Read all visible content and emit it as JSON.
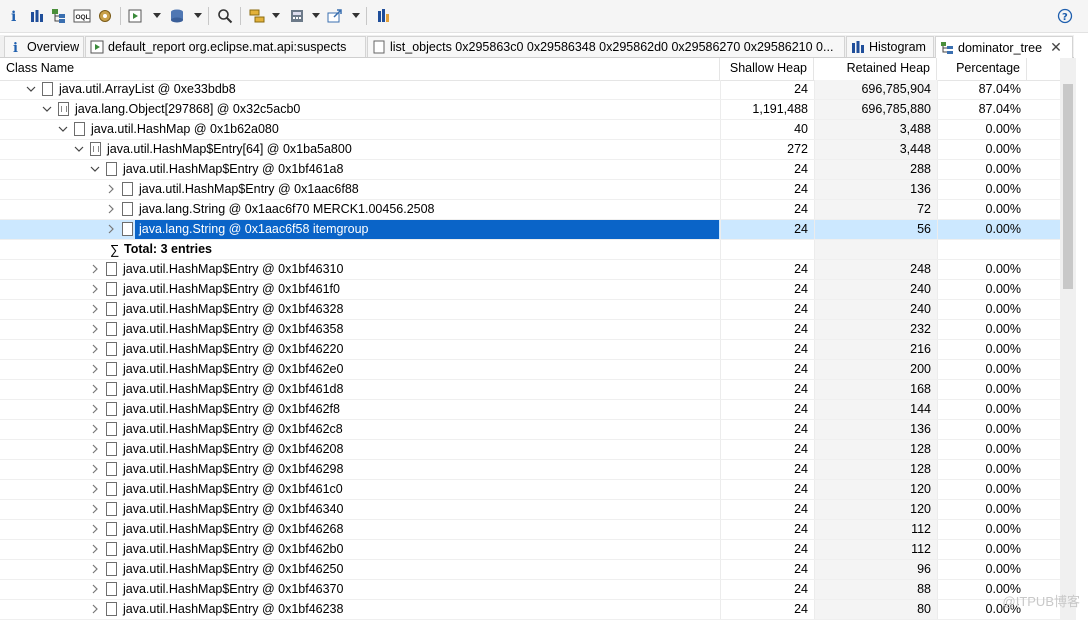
{
  "toolbar": {
    "buttons": [
      {
        "icon": "info-icon",
        "dropdown": false
      },
      {
        "icon": "histogram-icon",
        "dropdown": false
      },
      {
        "icon": "dominator-tree-icon",
        "dropdown": false
      },
      {
        "icon": "oql-icon",
        "dropdown": false
      },
      {
        "icon": "thread-overview-icon",
        "dropdown": false
      },
      {
        "icon": "run-report-icon",
        "dropdown": true
      },
      {
        "icon": "query-browser-icon",
        "dropdown": true
      },
      {
        "icon": "find-object-icon",
        "dropdown": false
      },
      {
        "icon": "group-by-icon",
        "dropdown": true
      },
      {
        "icon": "calculator-icon",
        "dropdown": true
      },
      {
        "icon": "export-icon",
        "dropdown": true
      },
      {
        "icon": "pin-icon",
        "dropdown": false
      }
    ],
    "oql_text": "OQL",
    "help_icon": "help-icon"
  },
  "tabs": [
    {
      "label": "Overview",
      "icon": "info-icon",
      "active": false
    },
    {
      "label": "default_report  org.eclipse.mat.api:suspects",
      "icon": "report-icon",
      "active": false
    },
    {
      "label": "list_objects  0x295863c0 0x29586348 0x295862d0 0x29586270 0x29586210 0...",
      "icon": "list-objects-icon",
      "active": false
    },
    {
      "label": "Histogram",
      "icon": "histogram-icon",
      "active": false
    },
    {
      "label": "dominator_tree",
      "icon": "dominator-tree-icon",
      "active": true
    }
  ],
  "table": {
    "columns": [
      "Class Name",
      "Shallow Heap",
      "Retained Heap",
      "Percentage"
    ],
    "rows": [
      {
        "depth": 0,
        "chevron": "down",
        "icon": "file",
        "name": "java.util.ArrayList @ 0xe33bdb8",
        "shallow": "24",
        "retained": "696,785,904",
        "percentage": "87.04%"
      },
      {
        "depth": 1,
        "chevron": "down",
        "icon": "array",
        "name": "java.lang.Object[297868] @ 0x32c5acb0",
        "shallow": "1,191,488",
        "retained": "696,785,880",
        "percentage": "87.04%"
      },
      {
        "depth": 2,
        "chevron": "down",
        "icon": "file",
        "name": "java.util.HashMap @ 0x1b62a080",
        "shallow": "40",
        "retained": "3,488",
        "percentage": "0.00%"
      },
      {
        "depth": 3,
        "chevron": "down",
        "icon": "array",
        "name": "java.util.HashMap$Entry[64] @ 0x1ba5a800",
        "shallow": "272",
        "retained": "3,448",
        "percentage": "0.00%"
      },
      {
        "depth": 4,
        "chevron": "down",
        "icon": "file",
        "name": "java.util.HashMap$Entry @ 0x1bf461a8",
        "shallow": "24",
        "retained": "288",
        "percentage": "0.00%"
      },
      {
        "depth": 5,
        "chevron": "right",
        "icon": "file",
        "name": "java.util.HashMap$Entry @ 0x1aac6f88",
        "shallow": "24",
        "retained": "136",
        "percentage": "0.00%"
      },
      {
        "depth": 5,
        "chevron": "right",
        "icon": "file",
        "name": "java.lang.String @ 0x1aac6f70  MERCK1.00456.2508",
        "shallow": "24",
        "retained": "72",
        "percentage": "0.00%"
      },
      {
        "depth": 5,
        "chevron": "right",
        "icon": "file",
        "name": "java.lang.String @ 0x1aac6f58  itemgroup",
        "shallow": "24",
        "retained": "56",
        "percentage": "0.00%",
        "selected": true
      },
      {
        "depth": 5,
        "chevron": "none",
        "icon": "sigma",
        "name": "Total: 3 entries",
        "shallow": "",
        "retained": "",
        "percentage": "",
        "bold": true
      },
      {
        "depth": 4,
        "chevron": "right",
        "icon": "file",
        "name": "java.util.HashMap$Entry @ 0x1bf46310",
        "shallow": "24",
        "retained": "248",
        "percentage": "0.00%"
      },
      {
        "depth": 4,
        "chevron": "right",
        "icon": "file",
        "name": "java.util.HashMap$Entry @ 0x1bf461f0",
        "shallow": "24",
        "retained": "240",
        "percentage": "0.00%"
      },
      {
        "depth": 4,
        "chevron": "right",
        "icon": "file",
        "name": "java.util.HashMap$Entry @ 0x1bf46328",
        "shallow": "24",
        "retained": "240",
        "percentage": "0.00%"
      },
      {
        "depth": 4,
        "chevron": "right",
        "icon": "file",
        "name": "java.util.HashMap$Entry @ 0x1bf46358",
        "shallow": "24",
        "retained": "232",
        "percentage": "0.00%"
      },
      {
        "depth": 4,
        "chevron": "right",
        "icon": "file",
        "name": "java.util.HashMap$Entry @ 0x1bf46220",
        "shallow": "24",
        "retained": "216",
        "percentage": "0.00%"
      },
      {
        "depth": 4,
        "chevron": "right",
        "icon": "file",
        "name": "java.util.HashMap$Entry @ 0x1bf462e0",
        "shallow": "24",
        "retained": "200",
        "percentage": "0.00%"
      },
      {
        "depth": 4,
        "chevron": "right",
        "icon": "file",
        "name": "java.util.HashMap$Entry @ 0x1bf461d8",
        "shallow": "24",
        "retained": "168",
        "percentage": "0.00%"
      },
      {
        "depth": 4,
        "chevron": "right",
        "icon": "file",
        "name": "java.util.HashMap$Entry @ 0x1bf462f8",
        "shallow": "24",
        "retained": "144",
        "percentage": "0.00%"
      },
      {
        "depth": 4,
        "chevron": "right",
        "icon": "file",
        "name": "java.util.HashMap$Entry @ 0x1bf462c8",
        "shallow": "24",
        "retained": "136",
        "percentage": "0.00%"
      },
      {
        "depth": 4,
        "chevron": "right",
        "icon": "file",
        "name": "java.util.HashMap$Entry @ 0x1bf46208",
        "shallow": "24",
        "retained": "128",
        "percentage": "0.00%"
      },
      {
        "depth": 4,
        "chevron": "right",
        "icon": "file",
        "name": "java.util.HashMap$Entry @ 0x1bf46298",
        "shallow": "24",
        "retained": "128",
        "percentage": "0.00%"
      },
      {
        "depth": 4,
        "chevron": "right",
        "icon": "file",
        "name": "java.util.HashMap$Entry @ 0x1bf461c0",
        "shallow": "24",
        "retained": "120",
        "percentage": "0.00%"
      },
      {
        "depth": 4,
        "chevron": "right",
        "icon": "file",
        "name": "java.util.HashMap$Entry @ 0x1bf46340",
        "shallow": "24",
        "retained": "120",
        "percentage": "0.00%"
      },
      {
        "depth": 4,
        "chevron": "right",
        "icon": "file",
        "name": "java.util.HashMap$Entry @ 0x1bf46268",
        "shallow": "24",
        "retained": "112",
        "percentage": "0.00%"
      },
      {
        "depth": 4,
        "chevron": "right",
        "icon": "file",
        "name": "java.util.HashMap$Entry @ 0x1bf462b0",
        "shallow": "24",
        "retained": "112",
        "percentage": "0.00%"
      },
      {
        "depth": 4,
        "chevron": "right",
        "icon": "file",
        "name": "java.util.HashMap$Entry @ 0x1bf46250",
        "shallow": "24",
        "retained": "96",
        "percentage": "0.00%"
      },
      {
        "depth": 4,
        "chevron": "right",
        "icon": "file",
        "name": "java.util.HashMap$Entry @ 0x1bf46370",
        "shallow": "24",
        "retained": "88",
        "percentage": "0.00%"
      },
      {
        "depth": 4,
        "chevron": "right",
        "icon": "file",
        "name": "java.util.HashMap$Entry @ 0x1bf46238",
        "shallow": "24",
        "retained": "80",
        "percentage": "0.00%"
      }
    ]
  },
  "watermark": "@ITPUB博客",
  "colors": {
    "selection": "#0a64c8",
    "row_highlight": "#cce8ff",
    "accent": "#1f5fae"
  }
}
